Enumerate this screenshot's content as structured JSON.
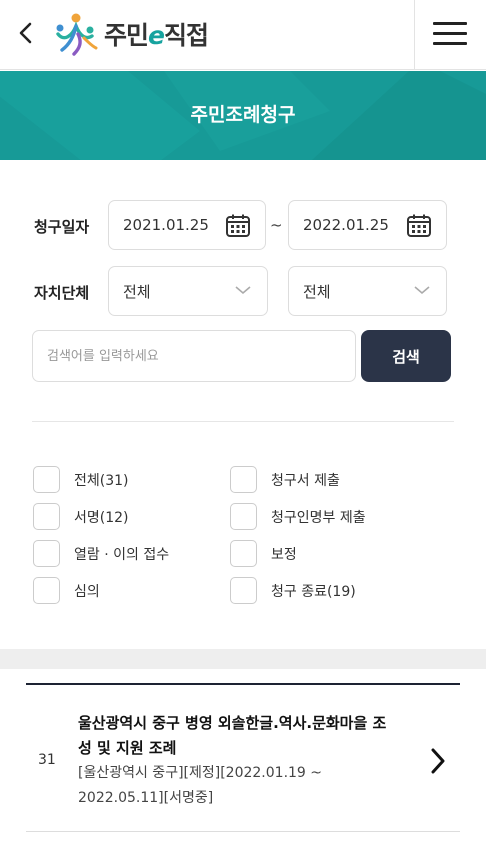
{
  "header": {
    "logo_main": "주민",
    "logo_e": "e",
    "logo_rest": "직접"
  },
  "banner": {
    "title": "주민조례청구"
  },
  "filters": {
    "date_label": "청구일자",
    "date_from": "2021.01.25",
    "date_to": "2022.01.25",
    "date_separator": "~",
    "region_label": "자치단체",
    "region_select_1": "전체",
    "region_select_2": "전체"
  },
  "search": {
    "placeholder": "검색어를 입력하세요",
    "button_label": "검색"
  },
  "checkboxes": {
    "left": [
      "전체(31)",
      "서명(12)",
      "열람 · 이의 접수",
      "심의"
    ],
    "right": [
      "청구서 제출",
      "청구인명부 제출",
      "보정",
      "청구 종료(19)"
    ]
  },
  "list": {
    "items": [
      {
        "number": "31",
        "title": "울산광역시 중구 병영 외솔한글.역사.문화마을 조성 및 지원 조례",
        "meta": "[울산광역시 중구][제정][2022.01.19 ~ 2022.05.11][서명중]"
      }
    ]
  },
  "colors": {
    "brand_teal": "#179a97",
    "button_dark": "#2b3448"
  },
  "icons": [
    "back-arrow-icon",
    "hamburger-menu-icon",
    "calendar-icon",
    "chevron-down-icon",
    "chevron-right-icon"
  ]
}
